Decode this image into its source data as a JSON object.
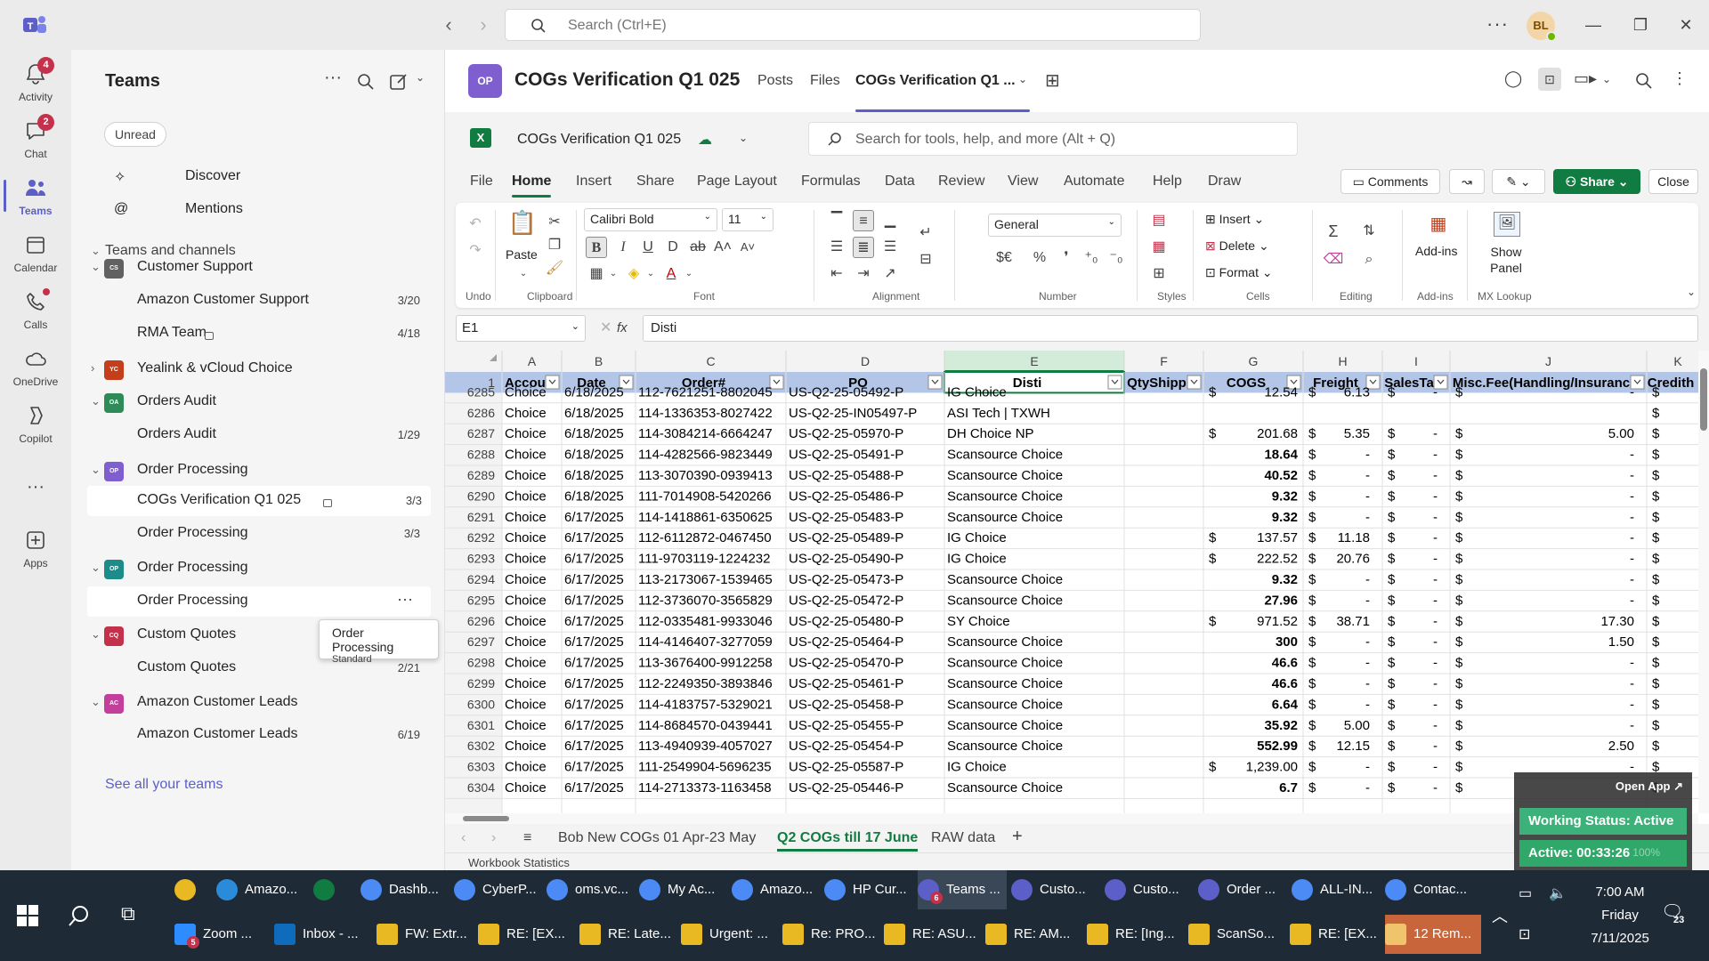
{
  "search": {
    "placeholder": "Search (Ctrl+E)"
  },
  "user": {
    "initials": "BL"
  },
  "rail": [
    {
      "label": "Activity",
      "badge": "4"
    },
    {
      "label": "Chat",
      "badge": "2"
    },
    {
      "label": "Teams"
    },
    {
      "label": "Calendar"
    },
    {
      "label": "Calls"
    },
    {
      "label": "OneDrive"
    },
    {
      "label": "Copilot"
    },
    {
      "label": "Apps"
    }
  ],
  "teams_panel": {
    "title": "Teams",
    "filter": "Unread",
    "discover": "Discover",
    "mentions": "Mentions",
    "section": "Teams and channels",
    "rows": [
      {
        "type": "team",
        "badge": "CS",
        "color": "#616161",
        "label": "Customer Support"
      },
      {
        "type": "channel",
        "label": "Amazon Customer Support",
        "count": "3/20"
      },
      {
        "type": "channel",
        "label": "RMA Team",
        "count": "4/18",
        "lock": true
      },
      {
        "type": "team",
        "badge": "YC",
        "color": "#c43e1c",
        "label": "Yealink & vCloud Choice",
        "collapsed": true
      },
      {
        "type": "team",
        "badge": "OA",
        "color": "#2e8b57",
        "label": "Orders Audit"
      },
      {
        "type": "channel",
        "label": "Orders Audit",
        "count": "1/29"
      },
      {
        "type": "team",
        "badge": "OP",
        "color": "#7f5fd0",
        "label": "Order Processing"
      },
      {
        "type": "channel",
        "label": "COGs Verification Q1 025",
        "count": "3/3",
        "lock": true,
        "selected": true
      },
      {
        "type": "channel",
        "label": "Order Processing",
        "count": "3/3"
      },
      {
        "type": "team",
        "badge": "OP",
        "color": "#1e8b8b",
        "label": "Order Processing"
      },
      {
        "type": "channel",
        "label": "Order Processing",
        "hover": true
      },
      {
        "type": "team",
        "badge": "CQ",
        "color": "#c4314b",
        "label": "Custom Quotes"
      },
      {
        "type": "channel",
        "label": "Custom Quotes",
        "count": "2/21"
      },
      {
        "type": "team",
        "badge": "AC",
        "color": "#c43e9c",
        "label": "Amazon Customer Leads"
      },
      {
        "type": "channel",
        "label": "Amazon Customer Leads",
        "count": "6/19"
      }
    ],
    "see_all": "See all your teams",
    "tooltip": {
      "title": "Order Processing",
      "subtitle": "Standard"
    }
  },
  "channel": {
    "avatar": "OP",
    "title": "COGs Verification Q1 025",
    "tabs": [
      "Posts",
      "Files",
      "COGs Verification Q1 ..."
    ]
  },
  "excel": {
    "logo": "X",
    "doc_name": "COGs Verification Q1 025",
    "search_placeholder": "Search for tools, help, and more (Alt + Q)",
    "menu": [
      "File",
      "Home",
      "Insert",
      "Share",
      "Page Layout",
      "Formulas",
      "Data",
      "Review",
      "View",
      "Automate",
      "Help",
      "Draw"
    ],
    "buttons": {
      "comments": "Comments",
      "share": "Share",
      "close": "Close"
    },
    "ribbon": {
      "groups": [
        "Undo",
        "Clipboard",
        "Font",
        "Alignment",
        "Number",
        "Styles",
        "Cells",
        "Editing",
        "Add-ins",
        "MX Lookup"
      ],
      "paste": "Paste",
      "font_name": "Calibri Bold",
      "font_size": "11",
      "number_format": "General",
      "insert": "Insert",
      "delete": "Delete",
      "format": "Format",
      "addins": "Add-ins",
      "show_panel": "Show Panel"
    },
    "name_box": "E1",
    "formula": "Disti",
    "sheets": [
      "Bob New COGs 01 Apr-23 May",
      "Q2 COGs till 17 June",
      "RAW data"
    ],
    "active_sheet": 1,
    "status": "Workbook Statistics"
  },
  "spreadsheet": {
    "columns": [
      "A",
      "B",
      "C",
      "D",
      "E",
      "F",
      "G",
      "H",
      "I",
      "J",
      "K"
    ],
    "headers": [
      "Accou",
      "Date",
      "Order#",
      "PO",
      "Disti",
      "QtyShipp",
      "COGS",
      "Freight",
      "SalesTa",
      "Misc.Fee(Handling/Insuranc",
      "Credith"
    ],
    "partial_row": [
      "6285",
      "Choice",
      "6/18/2025",
      "112-7621251-8802045",
      "US-Q2-25-05492-P",
      "IG Choice",
      "",
      "12.54",
      "6.13",
      "-",
      "-"
    ],
    "rows": [
      [
        "6286",
        "Choice",
        "6/18/2025",
        "114-1336353-8027422",
        "US-Q2-25-IN05497-P",
        "ASI Tech | TXWH",
        "",
        "",
        "",
        "",
        ""
      ],
      [
        "6287",
        "Choice",
        "6/18/2025",
        "114-3084214-6664247",
        "US-Q2-25-05970-P",
        "DH Choice NP",
        "",
        "201.68",
        "5.35",
        "-",
        "5.00"
      ],
      [
        "6288",
        "Choice",
        "6/18/2025",
        "114-4282566-9823449",
        "US-Q2-25-05491-P",
        "Scansource Choice",
        "",
        "18.64",
        "-",
        "-",
        "-"
      ],
      [
        "6289",
        "Choice",
        "6/18/2025",
        "113-3070390-0939413",
        "US-Q2-25-05488-P",
        "Scansource Choice",
        "",
        "40.52",
        "-",
        "-",
        "-"
      ],
      [
        "6290",
        "Choice",
        "6/18/2025",
        "111-7014908-5420266",
        "US-Q2-25-05486-P",
        "Scansource Choice",
        "",
        "9.32",
        "-",
        "-",
        "-"
      ],
      [
        "6291",
        "Choice",
        "6/17/2025",
        "114-1418861-6350625",
        "US-Q2-25-05483-P",
        "Scansource Choice",
        "",
        "9.32",
        "-",
        "-",
        "-"
      ],
      [
        "6292",
        "Choice",
        "6/17/2025",
        "112-6112872-0467450",
        "US-Q2-25-05489-P",
        "IG Choice",
        "",
        "137.57",
        "11.18",
        "-",
        "-"
      ],
      [
        "6293",
        "Choice",
        "6/17/2025",
        "111-9703119-1224232",
        "US-Q2-25-05490-P",
        "IG Choice",
        "",
        "222.52",
        "20.76",
        "-",
        "-"
      ],
      [
        "6294",
        "Choice",
        "6/17/2025",
        "113-2173067-1539465",
        "US-Q2-25-05473-P",
        "Scansource Choice",
        "",
        "9.32",
        "-",
        "-",
        "-"
      ],
      [
        "6295",
        "Choice",
        "6/17/2025",
        "112-3736070-3565829",
        "US-Q2-25-05472-P",
        "Scansource Choice",
        "",
        "27.96",
        "-",
        "-",
        "-"
      ],
      [
        "6296",
        "Choice",
        "6/17/2025",
        "112-0335481-9933046",
        "US-Q2-25-05480-P",
        "SY Choice",
        "",
        "971.52",
        "38.71",
        "-",
        "17.30"
      ],
      [
        "6297",
        "Choice",
        "6/17/2025",
        "114-4146407-3277059",
        "US-Q2-25-05464-P",
        "Scansource Choice",
        "",
        "300",
        "-",
        "-",
        "1.50"
      ],
      [
        "6298",
        "Choice",
        "6/17/2025",
        "113-3676400-9912258",
        "US-Q2-25-05470-P",
        "Scansource Choice",
        "",
        "46.6",
        "-",
        "-",
        "-"
      ],
      [
        "6299",
        "Choice",
        "6/17/2025",
        "112-2249350-3893846",
        "US-Q2-25-05461-P",
        "Scansource Choice",
        "",
        "46.6",
        "-",
        "-",
        "-"
      ],
      [
        "6300",
        "Choice",
        "6/17/2025",
        "114-4183757-5329021",
        "US-Q2-25-05458-P",
        "Scansource Choice",
        "",
        "6.64",
        "-",
        "-",
        "-"
      ],
      [
        "6301",
        "Choice",
        "6/17/2025",
        "114-8684570-0439441",
        "US-Q2-25-05455-P",
        "Scansource Choice",
        "",
        "35.92",
        "5.00",
        "-",
        "-"
      ],
      [
        "6302",
        "Choice",
        "6/17/2025",
        "113-4940939-4057027",
        "US-Q2-25-05454-P",
        "Scansource Choice",
        "",
        "552.99",
        "12.15",
        "-",
        "2.50"
      ],
      [
        "6303",
        "Choice",
        "6/17/2025",
        "111-2549904-5696235",
        "US-Q2-25-05587-P",
        "IG Choice",
        "",
        "1,239.00",
        "-",
        "-",
        "-"
      ],
      [
        "6304",
        "Choice",
        "6/17/2025",
        "114-2713373-1163458",
        "US-Q2-25-05446-P",
        "Scansource Choice",
        "",
        "6.7",
        "-",
        "-",
        "-"
      ]
    ],
    "currency_symbol": "$",
    "selected_column": "E"
  },
  "widget": {
    "open_app": "Open App ↗",
    "status": "Working Status: Active",
    "active": "Active: 00:33:26",
    "zoom": "100%"
  },
  "taskbar": {
    "row1": [
      {
        "label": "",
        "color": "#e8b923"
      },
      {
        "label": "Amazo...",
        "color": "#2a8bd8"
      },
      {
        "label": "",
        "color": "#107c41"
      },
      {
        "label": "Dashb...",
        "color": "#4c8bf5"
      },
      {
        "label": "CyberP...",
        "color": "#4c8bf5"
      },
      {
        "label": "oms.vc...",
        "color": "#4c8bf5"
      },
      {
        "label": "My Ac...",
        "color": "#4c8bf5"
      },
      {
        "label": "Amazo...",
        "color": "#4c8bf5"
      },
      {
        "label": "HP Cur...",
        "color": "#4c8bf5"
      },
      {
        "label": "Teams ...",
        "color": "#5b5fc7",
        "badge": "6"
      },
      {
        "label": "Custo...",
        "color": "#5b5fc7"
      },
      {
        "label": "Custo...",
        "color": "#5b5fc7"
      },
      {
        "label": "Order ...",
        "color": "#5b5fc7"
      },
      {
        "label": "ALL-IN...",
        "color": "#4c8bf5"
      },
      {
        "label": "Contac...",
        "color": "#4c8bf5"
      }
    ],
    "row2": [
      {
        "label": "Zoom ...",
        "color": "#2d8cff",
        "badge": "5"
      },
      {
        "label": "Inbox - ...",
        "color": "#0f6cbd"
      },
      {
        "label": "FW: Extr...",
        "color": "#e8b923"
      },
      {
        "label": "RE: [EX...",
        "color": "#e8b923"
      },
      {
        "label": "RE: Late...",
        "color": "#e8b923"
      },
      {
        "label": "Urgent: ...",
        "color": "#e8b923"
      },
      {
        "label": "Re: PRO...",
        "color": "#e8b923"
      },
      {
        "label": "RE: ASU...",
        "color": "#e8b923"
      },
      {
        "label": "RE: AM...",
        "color": "#e8b923"
      },
      {
        "label": "RE: [Ing...",
        "color": "#e8b923"
      },
      {
        "label": "ScanSo...",
        "color": "#e8b923"
      },
      {
        "label": "RE: [EX...",
        "color": "#e8b923"
      },
      {
        "label": "12 Rem...",
        "color": "#f0c36d"
      }
    ],
    "clock_time": "7:00 AM",
    "clock_day": "Friday",
    "clock_date": "7/11/2025",
    "notif_count": "23"
  }
}
